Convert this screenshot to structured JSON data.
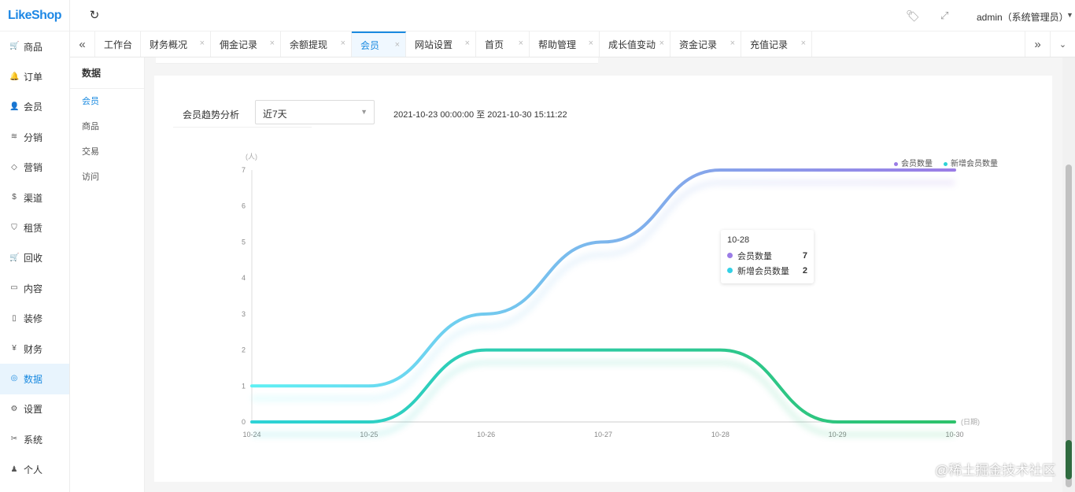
{
  "logo": "LikeShop",
  "sidebar": {
    "items": [
      {
        "label": "商品",
        "icon": "cart-icon",
        "glyph": "🛒"
      },
      {
        "label": "订单",
        "icon": "bell-icon",
        "glyph": "🔔"
      },
      {
        "label": "会员",
        "icon": "user-icon",
        "glyph": "👤"
      },
      {
        "label": "分销",
        "icon": "layers-icon",
        "glyph": "≋"
      },
      {
        "label": "营销",
        "icon": "diamond-icon",
        "glyph": "◇"
      },
      {
        "label": "渠道",
        "icon": "dollar-icon",
        "glyph": "$"
      },
      {
        "label": "租赁",
        "icon": "shield-icon",
        "glyph": "⛉"
      },
      {
        "label": "回收",
        "icon": "cart-icon",
        "glyph": "🛒"
      },
      {
        "label": "内容",
        "icon": "book-icon",
        "glyph": "▭"
      },
      {
        "label": "装修",
        "icon": "tablet-icon",
        "glyph": "▯"
      },
      {
        "label": "财务",
        "icon": "yen-icon",
        "glyph": "¥"
      },
      {
        "label": "数据",
        "icon": "globe-icon",
        "glyph": "◎",
        "active": true
      },
      {
        "label": "设置",
        "icon": "gear-icon",
        "glyph": "⚙"
      },
      {
        "label": "系统",
        "icon": "scissors-icon",
        "glyph": "✂"
      },
      {
        "label": "个人",
        "icon": "person-icon",
        "glyph": "♟"
      }
    ]
  },
  "topbar": {
    "refresh_glyph": "↻",
    "tag_glyph": "🏷",
    "fullscreen_glyph": "⤢",
    "user": "admin（系统管理员）",
    "caret": "▼"
  },
  "tabs": {
    "left_arrow": "«",
    "right_arrow": "»",
    "caret": "⌄",
    "close_glyph": "×",
    "items": [
      {
        "label": "工作台"
      },
      {
        "label": "财务概况"
      },
      {
        "label": "佣金记录"
      },
      {
        "label": "余额提现"
      },
      {
        "label": "会员",
        "active": true
      },
      {
        "label": "网站设置"
      },
      {
        "label": "首页"
      },
      {
        "label": "帮助管理"
      },
      {
        "label": "成长值变动"
      },
      {
        "label": "资金记录"
      },
      {
        "label": "充值记录"
      }
    ]
  },
  "subnav": {
    "title": "数据",
    "items": [
      {
        "label": "会员",
        "active": true
      },
      {
        "label": "商品"
      },
      {
        "label": "交易"
      },
      {
        "label": "访问"
      }
    ]
  },
  "filter": {
    "label": "会员趋势分析",
    "select_value": "近7天",
    "select_caret": "▼",
    "date_range": "2021-10-23 00:00:00 至 2021-10-30 15:11:22"
  },
  "chart_data": {
    "type": "line",
    "smooth": true,
    "ylabel": "(人)",
    "xlabel": "(日期)",
    "ylim": [
      0,
      7
    ],
    "yticks": [
      0,
      1,
      2,
      3,
      4,
      5,
      6,
      7
    ],
    "x": [
      "10-24",
      "10-25",
      "10-26",
      "10-27",
      "10-28",
      "10-29",
      "10-30"
    ],
    "series": [
      {
        "name": "会员数量",
        "values": [
          1,
          1,
          3,
          5,
          7,
          7,
          7
        ],
        "color": "#9b7ce6",
        "gradient_start": "#5ef0f3"
      },
      {
        "name": "新增会员数量",
        "values": [
          0,
          0,
          2,
          2,
          2,
          0,
          0
        ],
        "color": "#2ec26b",
        "gradient_start": "#2ed3d7"
      }
    ],
    "legend": "top-right",
    "grid": false,
    "tooltip": {
      "title": "10-28",
      "rows": [
        {
          "name": "会员数量",
          "value": "7",
          "color": "#9b7ce6"
        },
        {
          "name": "新增会员数量",
          "value": "2",
          "color": "#34d1e6"
        }
      ]
    }
  },
  "watermark": "@稀土掘金技术社区"
}
